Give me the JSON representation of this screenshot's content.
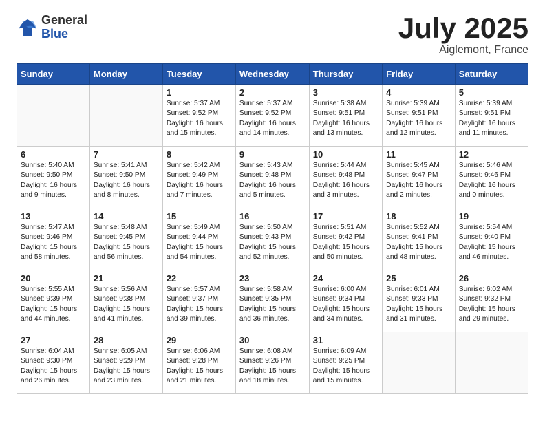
{
  "logo": {
    "general": "General",
    "blue": "Blue"
  },
  "title": "July 2025",
  "subtitle": "Aiglemont, France",
  "days_of_week": [
    "Sunday",
    "Monday",
    "Tuesday",
    "Wednesday",
    "Thursday",
    "Friday",
    "Saturday"
  ],
  "weeks": [
    [
      {
        "day": "",
        "info": ""
      },
      {
        "day": "",
        "info": ""
      },
      {
        "day": "1",
        "info": "Sunrise: 5:37 AM\nSunset: 9:52 PM\nDaylight: 16 hours and 15 minutes."
      },
      {
        "day": "2",
        "info": "Sunrise: 5:37 AM\nSunset: 9:52 PM\nDaylight: 16 hours and 14 minutes."
      },
      {
        "day": "3",
        "info": "Sunrise: 5:38 AM\nSunset: 9:51 PM\nDaylight: 16 hours and 13 minutes."
      },
      {
        "day": "4",
        "info": "Sunrise: 5:39 AM\nSunset: 9:51 PM\nDaylight: 16 hours and 12 minutes."
      },
      {
        "day": "5",
        "info": "Sunrise: 5:39 AM\nSunset: 9:51 PM\nDaylight: 16 hours and 11 minutes."
      }
    ],
    [
      {
        "day": "6",
        "info": "Sunrise: 5:40 AM\nSunset: 9:50 PM\nDaylight: 16 hours and 9 minutes."
      },
      {
        "day": "7",
        "info": "Sunrise: 5:41 AM\nSunset: 9:50 PM\nDaylight: 16 hours and 8 minutes."
      },
      {
        "day": "8",
        "info": "Sunrise: 5:42 AM\nSunset: 9:49 PM\nDaylight: 16 hours and 7 minutes."
      },
      {
        "day": "9",
        "info": "Sunrise: 5:43 AM\nSunset: 9:48 PM\nDaylight: 16 hours and 5 minutes."
      },
      {
        "day": "10",
        "info": "Sunrise: 5:44 AM\nSunset: 9:48 PM\nDaylight: 16 hours and 3 minutes."
      },
      {
        "day": "11",
        "info": "Sunrise: 5:45 AM\nSunset: 9:47 PM\nDaylight: 16 hours and 2 minutes."
      },
      {
        "day": "12",
        "info": "Sunrise: 5:46 AM\nSunset: 9:46 PM\nDaylight: 16 hours and 0 minutes."
      }
    ],
    [
      {
        "day": "13",
        "info": "Sunrise: 5:47 AM\nSunset: 9:46 PM\nDaylight: 15 hours and 58 minutes."
      },
      {
        "day": "14",
        "info": "Sunrise: 5:48 AM\nSunset: 9:45 PM\nDaylight: 15 hours and 56 minutes."
      },
      {
        "day": "15",
        "info": "Sunrise: 5:49 AM\nSunset: 9:44 PM\nDaylight: 15 hours and 54 minutes."
      },
      {
        "day": "16",
        "info": "Sunrise: 5:50 AM\nSunset: 9:43 PM\nDaylight: 15 hours and 52 minutes."
      },
      {
        "day": "17",
        "info": "Sunrise: 5:51 AM\nSunset: 9:42 PM\nDaylight: 15 hours and 50 minutes."
      },
      {
        "day": "18",
        "info": "Sunrise: 5:52 AM\nSunset: 9:41 PM\nDaylight: 15 hours and 48 minutes."
      },
      {
        "day": "19",
        "info": "Sunrise: 5:54 AM\nSunset: 9:40 PM\nDaylight: 15 hours and 46 minutes."
      }
    ],
    [
      {
        "day": "20",
        "info": "Sunrise: 5:55 AM\nSunset: 9:39 PM\nDaylight: 15 hours and 44 minutes."
      },
      {
        "day": "21",
        "info": "Sunrise: 5:56 AM\nSunset: 9:38 PM\nDaylight: 15 hours and 41 minutes."
      },
      {
        "day": "22",
        "info": "Sunrise: 5:57 AM\nSunset: 9:37 PM\nDaylight: 15 hours and 39 minutes."
      },
      {
        "day": "23",
        "info": "Sunrise: 5:58 AM\nSunset: 9:35 PM\nDaylight: 15 hours and 36 minutes."
      },
      {
        "day": "24",
        "info": "Sunrise: 6:00 AM\nSunset: 9:34 PM\nDaylight: 15 hours and 34 minutes."
      },
      {
        "day": "25",
        "info": "Sunrise: 6:01 AM\nSunset: 9:33 PM\nDaylight: 15 hours and 31 minutes."
      },
      {
        "day": "26",
        "info": "Sunrise: 6:02 AM\nSunset: 9:32 PM\nDaylight: 15 hours and 29 minutes."
      }
    ],
    [
      {
        "day": "27",
        "info": "Sunrise: 6:04 AM\nSunset: 9:30 PM\nDaylight: 15 hours and 26 minutes."
      },
      {
        "day": "28",
        "info": "Sunrise: 6:05 AM\nSunset: 9:29 PM\nDaylight: 15 hours and 23 minutes."
      },
      {
        "day": "29",
        "info": "Sunrise: 6:06 AM\nSunset: 9:28 PM\nDaylight: 15 hours and 21 minutes."
      },
      {
        "day": "30",
        "info": "Sunrise: 6:08 AM\nSunset: 9:26 PM\nDaylight: 15 hours and 18 minutes."
      },
      {
        "day": "31",
        "info": "Sunrise: 6:09 AM\nSunset: 9:25 PM\nDaylight: 15 hours and 15 minutes."
      },
      {
        "day": "",
        "info": ""
      },
      {
        "day": "",
        "info": ""
      }
    ]
  ]
}
